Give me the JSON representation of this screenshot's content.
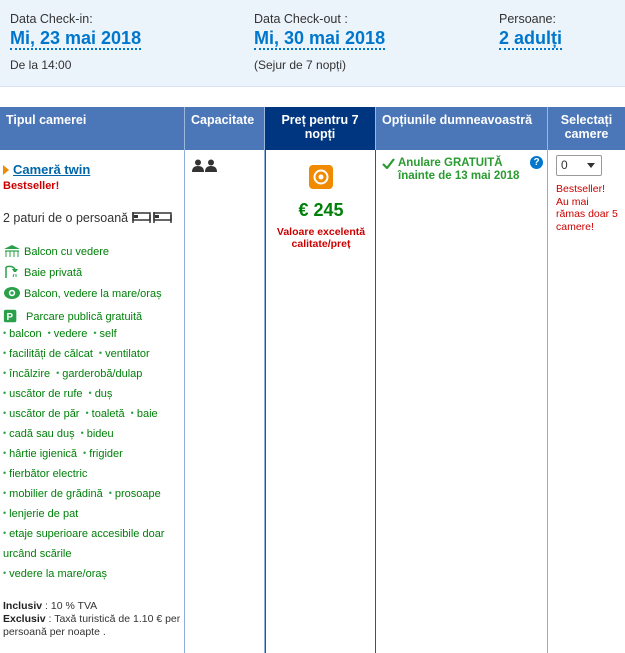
{
  "summary": {
    "checkin": {
      "label": "Data Check-in:",
      "value": "Mi, 23 mai 2018",
      "sub": "De la 14:00"
    },
    "checkout": {
      "label": "Data Check-out :",
      "value": "Mi, 30 mai 2018",
      "sub": "(Sejur de 7 nopți)"
    },
    "guests": {
      "label": "Persoane:",
      "value": "2 adulți"
    }
  },
  "table": {
    "headers": {
      "room_type": "Tipul camerei",
      "capacity": "Capacitate",
      "price": "Preț pentru 7 nopți",
      "options": "Opțiunile dumneavoastră",
      "select": "Selectați camere"
    },
    "room": {
      "name": "Cameră twin",
      "bestseller": "Bestseller!",
      "beds": "2 paturi de o persoană",
      "facilities_icon": [
        {
          "icon": "balcony-icon",
          "label": "Balcon cu vedere"
        },
        {
          "icon": "shower-icon",
          "label": "Baie privată"
        },
        {
          "icon": "eye-icon",
          "label": "Balcon, vedere la mare/oraș"
        },
        {
          "icon": "parking-icon",
          "label": "Parcare publică gratuită"
        }
      ],
      "amenity_lines": [
        [
          "balcon",
          "vedere",
          "self"
        ],
        [
          "facilități de călcat",
          "ventilator"
        ],
        [
          "încălzire",
          "garderobă/dulap"
        ],
        [
          "uscător de rufe",
          "duș"
        ],
        [
          "uscător de păr",
          "toaletă",
          "baie"
        ],
        [
          "cadă sau duș",
          "bideu"
        ],
        [
          "hârtie igienică",
          "frigider"
        ],
        [
          "fierbător electric"
        ],
        [
          "mobilier de grădină",
          "prosoape"
        ],
        [
          "lenjerie de pat"
        ],
        [
          "etaje superioare accesibile doar"
        ],
        [
          "",
          "urcând scările"
        ],
        [
          "vedere la mare/oraș"
        ]
      ],
      "inclusive_label": "Inclusiv",
      "inclusive_text": ": 10 % TVA",
      "exclusive_label": "Exclusiv",
      "exclusive_text": ": Taxă turistică de 1.10 € per persoană per noapte ."
    },
    "price": {
      "value": "€ 245",
      "note": "Valoare excelentă calitate/preț"
    },
    "options": {
      "text": "Anulare GRATUITĂ înainte de 13 mai 2018",
      "help": "?"
    },
    "select": {
      "value": "0",
      "scarcity": "Bestseller! Au mai rămas doar 5 camere!"
    }
  },
  "colors": {
    "header_bg": "#4b76b7",
    "header_active": "#003580",
    "link_blue": "#0077cc",
    "green": "#008009",
    "red": "#cc0000",
    "summary_bg": "#ebf3fb"
  }
}
